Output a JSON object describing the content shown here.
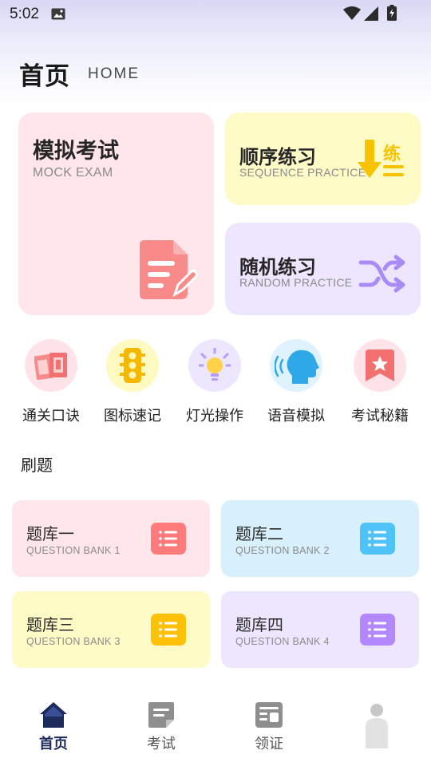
{
  "status_bar": {
    "time": "5:02"
  },
  "header": {
    "title": "首页",
    "subtitle": "HOME"
  },
  "cards": {
    "mock": {
      "title": "模拟考试",
      "subtitle": "MOCK EXAM"
    },
    "sequence": {
      "title": "顺序练习",
      "subtitle": "SEQUENCE PRACTICE",
      "icon_char": "练"
    },
    "random": {
      "title": "随机练习",
      "subtitle": "RANDOM PRACTICE"
    }
  },
  "quick_links": [
    {
      "label": "通关口诀",
      "icon": "tickets-icon"
    },
    {
      "label": "图标速记",
      "icon": "traffic-light-icon"
    },
    {
      "label": "灯光操作",
      "icon": "light-bulb-icon"
    },
    {
      "label": "语音模拟",
      "icon": "voice-head-icon"
    },
    {
      "label": "考试秘籍",
      "icon": "bookmark-star-icon"
    }
  ],
  "section": {
    "title": "刷题"
  },
  "banks": [
    {
      "title": "题库一",
      "subtitle": "QUESTION BANK 1"
    },
    {
      "title": "题库二",
      "subtitle": "QUESTION BANK 2"
    },
    {
      "title": "题库三",
      "subtitle": "QUESTION BANK 3"
    },
    {
      "title": "题库四",
      "subtitle": "QUESTION BANK 4"
    }
  ],
  "nav": [
    {
      "label": "首页",
      "active": true
    },
    {
      "label": "考试",
      "active": false
    },
    {
      "label": "领证",
      "active": false
    }
  ],
  "colors": {
    "mock_bg": "#ffe6ea",
    "sequence_bg": "#fffbc7",
    "random_bg": "#eee6ff",
    "bank1": "#ff7b7b",
    "bank2": "#4fc3f7",
    "bank3": "#ffc107",
    "bank4": "#b388ff",
    "nav_active": "#1d2b5c"
  }
}
